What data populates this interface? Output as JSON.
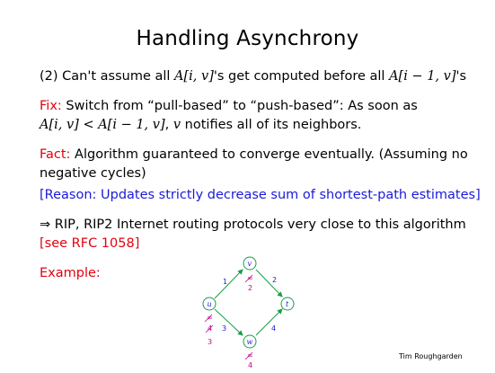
{
  "slide": {
    "title": "Handling Asynchrony",
    "item2": {
      "prefix": "(2) Can't assume all ",
      "expr1": "A[i, v]",
      "mid": "'s get computed before all ",
      "expr2": "A[i − 1, v]",
      "suffix": "'s"
    },
    "fix": {
      "label": "Fix:",
      "text1": " Switch from “pull-based” to “push-based”: As soon as",
      "expr1": "A[i, v] < A[i − 1, v]",
      "text2": ", ",
      "expr2": "v",
      "text3": " notifies all of its neighbors."
    },
    "fact": {
      "label": "Fact:",
      "text1": " Algorithm guaranteed to converge eventually. (Assuming no",
      "text2": "negative cycles)"
    },
    "reason": "[Reason: Updates strictly decrease sum of shortest-path estimates]",
    "rip": {
      "text": "⇒ RIP, RIP2 Internet routing protocols very close to this algorithm",
      "ref": "[see RFC 1058]"
    },
    "example_label": "Example:",
    "author": "Tim Roughgarden"
  },
  "graph": {
    "nodes": {
      "v": "v",
      "u": "u",
      "t": "t",
      "w": "w"
    },
    "edge_labels": {
      "uv": "1",
      "vt": "2",
      "uw": "3",
      "wt": "4"
    },
    "estimates": {
      "v_old": "∞",
      "v_new": "2",
      "u_old1": "∞",
      "u_old2": "4",
      "u_new": "3",
      "w_old": "∞",
      "w_new": "4"
    },
    "colors": {
      "node_stroke": "#1a9c4a",
      "edge_label": "#1a1adb",
      "estimate": "#c4008c",
      "highlight": "#e4000f"
    }
  }
}
